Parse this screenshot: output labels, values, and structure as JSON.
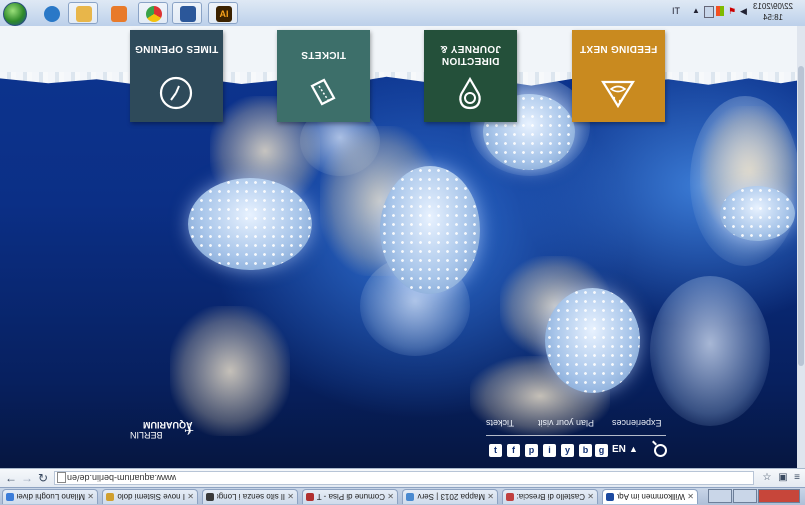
{
  "taskbar": {
    "apps": [
      {
        "name": "internet-explorer",
        "color": "#2a78c7"
      },
      {
        "name": "file-explorer",
        "color": "#e8b64a"
      },
      {
        "name": "media-player",
        "color": "#e87a2a"
      },
      {
        "name": "chrome",
        "color": "#3aa34a"
      },
      {
        "name": "word-document",
        "color": "#2b579a"
      },
      {
        "name": "illustrator",
        "color": "#3b2200"
      }
    ],
    "clock_time": "18:54",
    "clock_date": "22/09/2013",
    "lang_indicator": "IT"
  },
  "nav_tiles": [
    {
      "label": "TIMES OPENING",
      "icon": "clock-icon",
      "color": "#2e4a5a"
    },
    {
      "label": "TICKETS",
      "icon": "ticket-icon",
      "color": "#3d6f6a"
    },
    {
      "label": "DIRECTION JOURNEY &",
      "icon": "water-drop-icon",
      "color": "#24503a"
    },
    {
      "label": "FEEDING NEXT",
      "icon": "fish-feeding-icon",
      "color": "#c98a1f"
    }
  ],
  "logo": {
    "line1": "AQUARIUM",
    "line2": "BERLIN"
  },
  "footer": {
    "links": [
      "Tickets",
      "Plan your visit",
      "Experiences"
    ],
    "language": "EN",
    "social": [
      "t",
      "f",
      "p",
      "i",
      "y",
      "b",
      "g"
    ]
  },
  "browser": {
    "url": "www.aquarium-berlin.de/en",
    "tabs": [
      {
        "title": "Milano Luoghi diversi",
        "fav": "#3c7dd9"
      },
      {
        "title": "I nove Sistemi dolomit",
        "fav": "#d0a030"
      },
      {
        "title": "Il sito senza i Longobar",
        "fav": "#3a3a3a"
      },
      {
        "title": "Comune di Pisa - Turi",
        "fav": "#b03030"
      },
      {
        "title": "Mappa 2013 | Servizio",
        "fav": "#4a8ad0"
      },
      {
        "title": "Castello di Brescia: il Ci",
        "fav": "#c04040"
      },
      {
        "title": "Willkommen im Aque",
        "fav": "#1c4aa0",
        "active": true
      }
    ]
  }
}
